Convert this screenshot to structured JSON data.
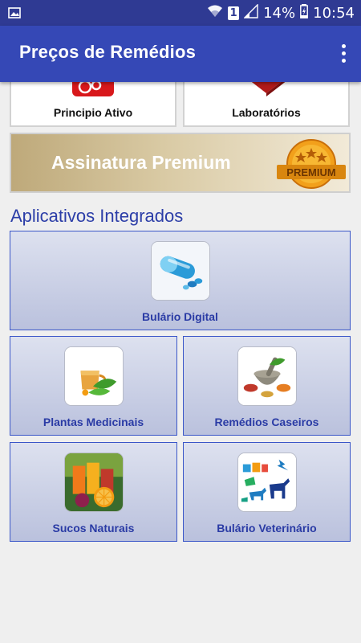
{
  "status_bar": {
    "notification_icon": "image-icon",
    "wifi_icon": "wifi-icon",
    "sim_badge": "1",
    "signal_icon": "signal-icon",
    "battery_percent": "14%",
    "battery_icon": "battery-charging-icon",
    "time": "10:54"
  },
  "app_bar": {
    "title": "Preços de Remédios",
    "overflow_icon": "more-vert-icon"
  },
  "top_cards": [
    {
      "label": "Principio Ativo"
    },
    {
      "label": "Laboratórios"
    }
  ],
  "premium": {
    "label": "Assinatura Premium",
    "badge_text": "PREMIUM"
  },
  "section": {
    "title": "Aplicativos Integrados"
  },
  "apps": [
    {
      "label": "Bulário Digital",
      "icon": "capsule-icon"
    },
    {
      "label": "Plantas Medicinais",
      "icon": "herbal-tea-icon"
    },
    {
      "label": "Remédios Caseiros",
      "icon": "mortar-pestle-icon"
    },
    {
      "label": "Sucos Naturais",
      "icon": "juice-icon"
    },
    {
      "label": "Bulário Veterinário",
      "icon": "animals-icon"
    }
  ],
  "colors": {
    "status_bar": "#2f3a93",
    "app_bar": "#3548b6",
    "accent_text": "#2a3ba5",
    "tile_border": "#3a56c8",
    "background": "#efefef"
  }
}
